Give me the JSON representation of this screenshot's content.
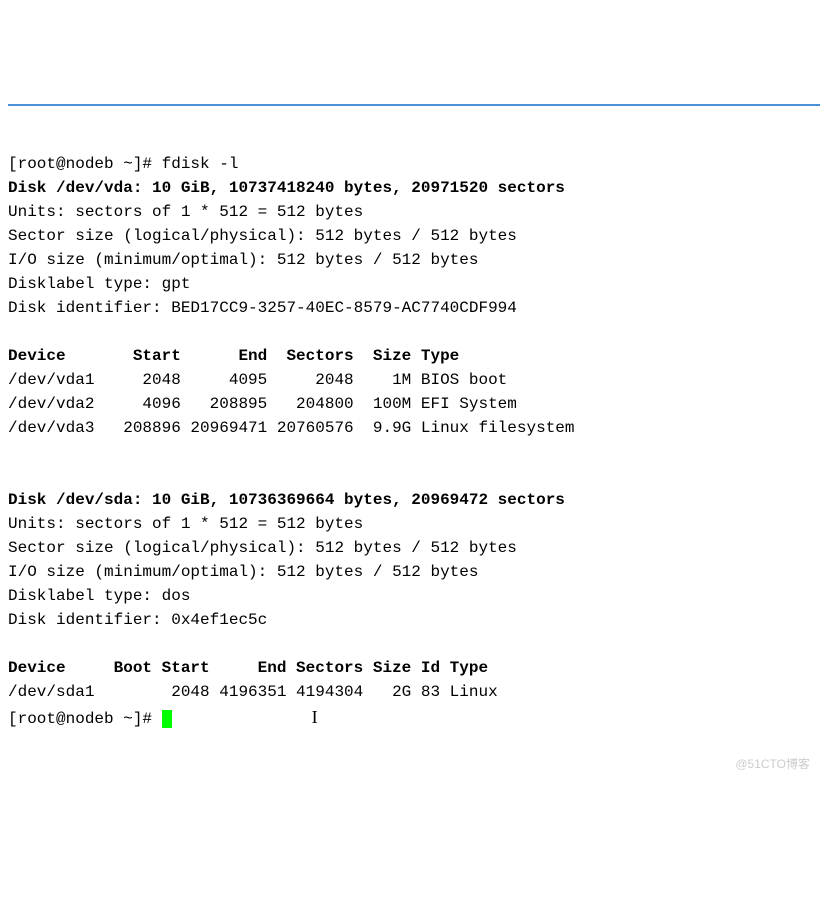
{
  "prompt1": {
    "user_host": "[root@nodeb ~]# ",
    "command": "fdisk -l"
  },
  "disk1": {
    "header": "Disk /dev/vda: 10 GiB, 10737418240 bytes, 20971520 sectors",
    "units": "Units: sectors of 1 * 512 = 512 bytes",
    "sector_size": "Sector size (logical/physical): 512 bytes / 512 bytes",
    "io_size": "I/O size (minimum/optimal): 512 bytes / 512 bytes",
    "label_type": "Disklabel type: gpt",
    "identifier": "Disk identifier: BED17CC9-3257-40EC-8579-AC7740CDF994",
    "table_header": "Device       Start      End  Sectors  Size Type",
    "rows": [
      "/dev/vda1     2048     4095     2048    1M BIOS boot",
      "/dev/vda2     4096   208895   204800  100M EFI System",
      "/dev/vda3   208896 20969471 20760576  9.9G Linux filesystem"
    ]
  },
  "disk2": {
    "header": "Disk /dev/sda: 10 GiB, 10736369664 bytes, 20969472 sectors",
    "units": "Units: sectors of 1 * 512 = 512 bytes",
    "sector_size": "Sector size (logical/physical): 512 bytes / 512 bytes",
    "io_size": "I/O size (minimum/optimal): 512 bytes / 512 bytes",
    "label_type": "Disklabel type: dos",
    "identifier": "Disk identifier: 0x4ef1ec5c",
    "table_header": "Device     Boot Start     End Sectors Size Id Type",
    "rows": [
      "/dev/sda1        2048 4196351 4194304   2G 83 Linux"
    ]
  },
  "prompt2": {
    "user_host": "[root@nodeb ~]# "
  },
  "watermark": "@51CTO博客"
}
